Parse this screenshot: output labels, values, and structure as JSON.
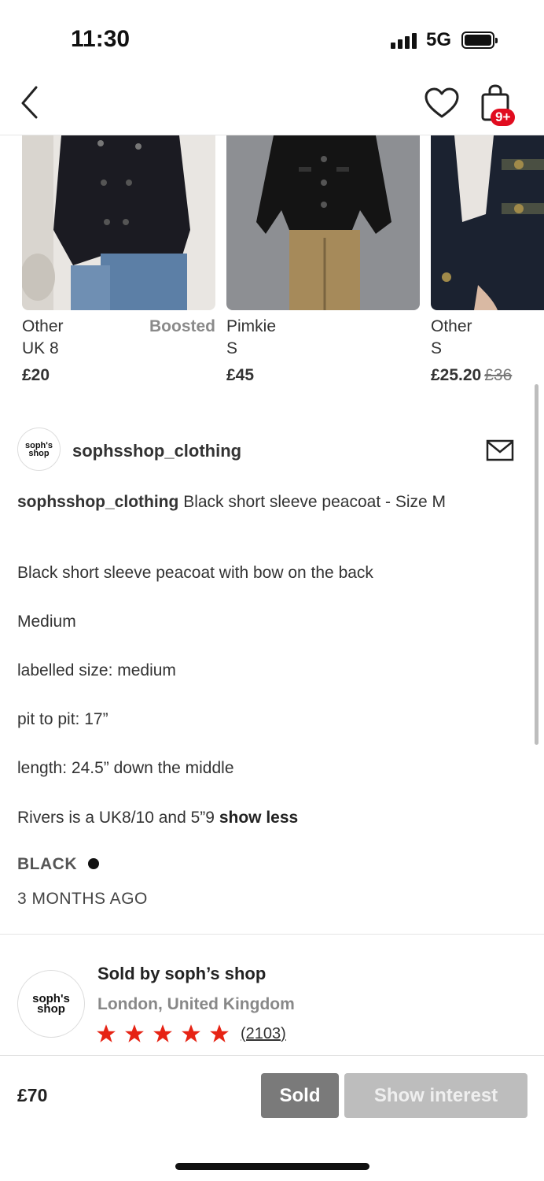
{
  "status_bar": {
    "time": "11:30",
    "network": "5G"
  },
  "nav": {
    "back_icon": "chevron-left-icon",
    "like_icon": "heart-icon",
    "bag_icon": "shopping-bag-icon",
    "bag_badge": "9+",
    "badge_color": "#e10c1f"
  },
  "related_items": [
    {
      "brand": "Other",
      "boosted": "Boosted",
      "size": "UK 8",
      "price": "£20"
    },
    {
      "brand": "Pimkie",
      "size": "S",
      "price": "£45"
    },
    {
      "brand": "Other",
      "size": "S",
      "price": "£25.20",
      "old_price": "£36"
    }
  ],
  "shop": {
    "avatar_text_line1": "soph's",
    "avatar_text_line2": "shop",
    "handle": "sophsshop_clothing",
    "message_icon": "mail-icon"
  },
  "description": {
    "title_user": "sophsshop_clothing",
    "title_text": "Black short sleeve peacoat - Size M",
    "lines": [
      "Black short sleeve peacoat with bow on the back",
      "Medium",
      "labelled size: medium",
      "pit to pit: 17”",
      "length: 24.5” down the middle",
      "Rivers is a UK8/10 and 5”9"
    ],
    "show_less": "show less",
    "color": "BLACK",
    "color_swatch": "#111111",
    "posted": "3 MONTHS AGO"
  },
  "seller": {
    "avatar_text_line1": "soph's",
    "avatar_text_line2": "shop",
    "sold_by": "Sold by soph’s shop",
    "location": "London, United Kingdom",
    "rating_stars": 5,
    "star_color": "#e62314",
    "review_count": "(2103)"
  },
  "bottom_bar": {
    "price": "£70",
    "sold_label": "Sold",
    "interest_label": "Show interest"
  }
}
